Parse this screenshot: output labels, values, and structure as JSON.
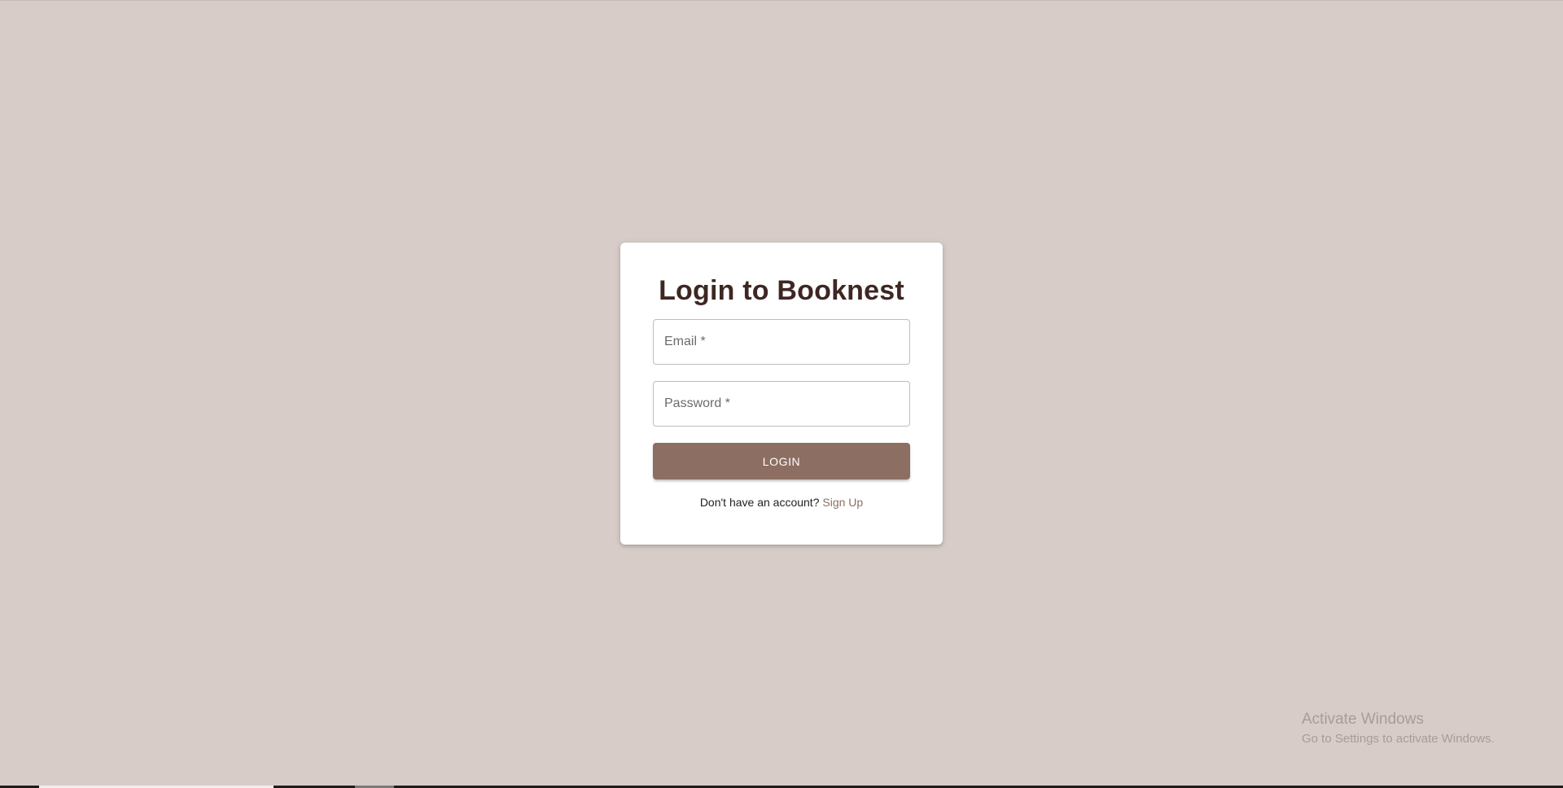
{
  "app": {
    "title": "Login to Booknest"
  },
  "form": {
    "email_label": "Email *",
    "email_value": "",
    "password_label": "Password *",
    "password_value": "",
    "login_label": "LOGIN"
  },
  "signup": {
    "prompt": "Don't have an account?",
    "link_label": "Sign Up"
  },
  "watermark": {
    "title": "Activate Windows",
    "subtitle": "Go to Settings to activate Windows."
  },
  "colors": {
    "background": "#d7ccc8",
    "title": "#3e2723",
    "accent": "#8d6e63",
    "card": "#ffffff"
  }
}
